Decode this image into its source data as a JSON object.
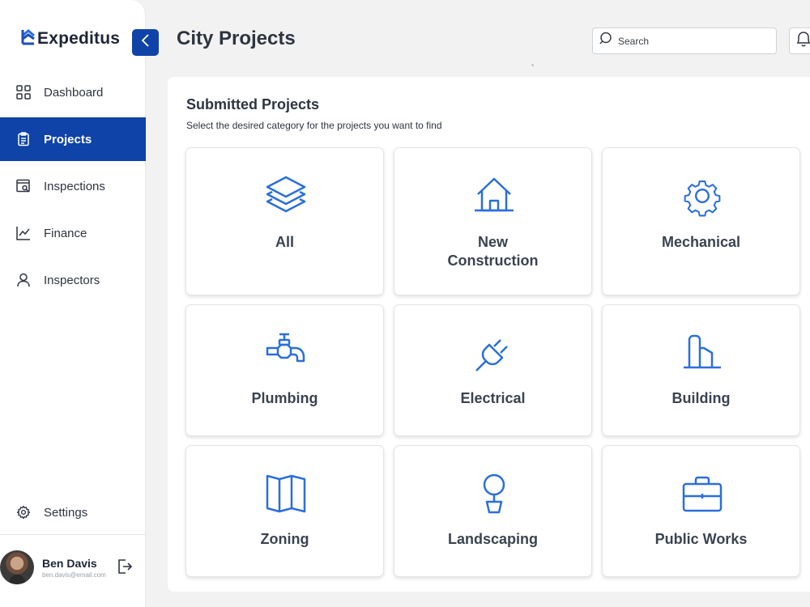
{
  "app": {
    "name": "Expeditus"
  },
  "sidebar": {
    "items": [
      {
        "label": "Dashboard",
        "icon": "grid-icon",
        "active": false
      },
      {
        "label": "Projects",
        "icon": "clipboard-icon",
        "active": true
      },
      {
        "label": "Inspections",
        "icon": "inspection-icon",
        "active": false
      },
      {
        "label": "Finance",
        "icon": "chart-line-icon",
        "active": false
      },
      {
        "label": "Inspectors",
        "icon": "user-icon",
        "active": false
      }
    ],
    "settings_label": "Settings",
    "user": {
      "name": "Ben Davis",
      "email": "ben.davis@email.com"
    }
  },
  "header": {
    "title": "City Projects",
    "search": {
      "placeholder": "Search",
      "value": ""
    }
  },
  "panel": {
    "title": "Submitted Projects",
    "subtitle": "Select the desired category for the projects you want to find",
    "categories": [
      {
        "label": "All",
        "icon": "layers-icon"
      },
      {
        "label": "New\nConstruction",
        "icon": "house-icon"
      },
      {
        "label": "Mechanical",
        "icon": "gear-icon"
      },
      {
        "label": "Plumbing",
        "icon": "faucet-icon"
      },
      {
        "label": "Electrical",
        "icon": "plug-icon"
      },
      {
        "label": "Building",
        "icon": "building-icon"
      },
      {
        "label": "Zoning",
        "icon": "map-icon"
      },
      {
        "label": "Landscaping",
        "icon": "tree-icon"
      },
      {
        "label": "Public Works",
        "icon": "briefcase-icon"
      }
    ]
  },
  "colors": {
    "accent": "#0f43a8",
    "icon_blue": "#2a6fdb",
    "text": "#2e3440",
    "background": "#f2f2f2"
  }
}
